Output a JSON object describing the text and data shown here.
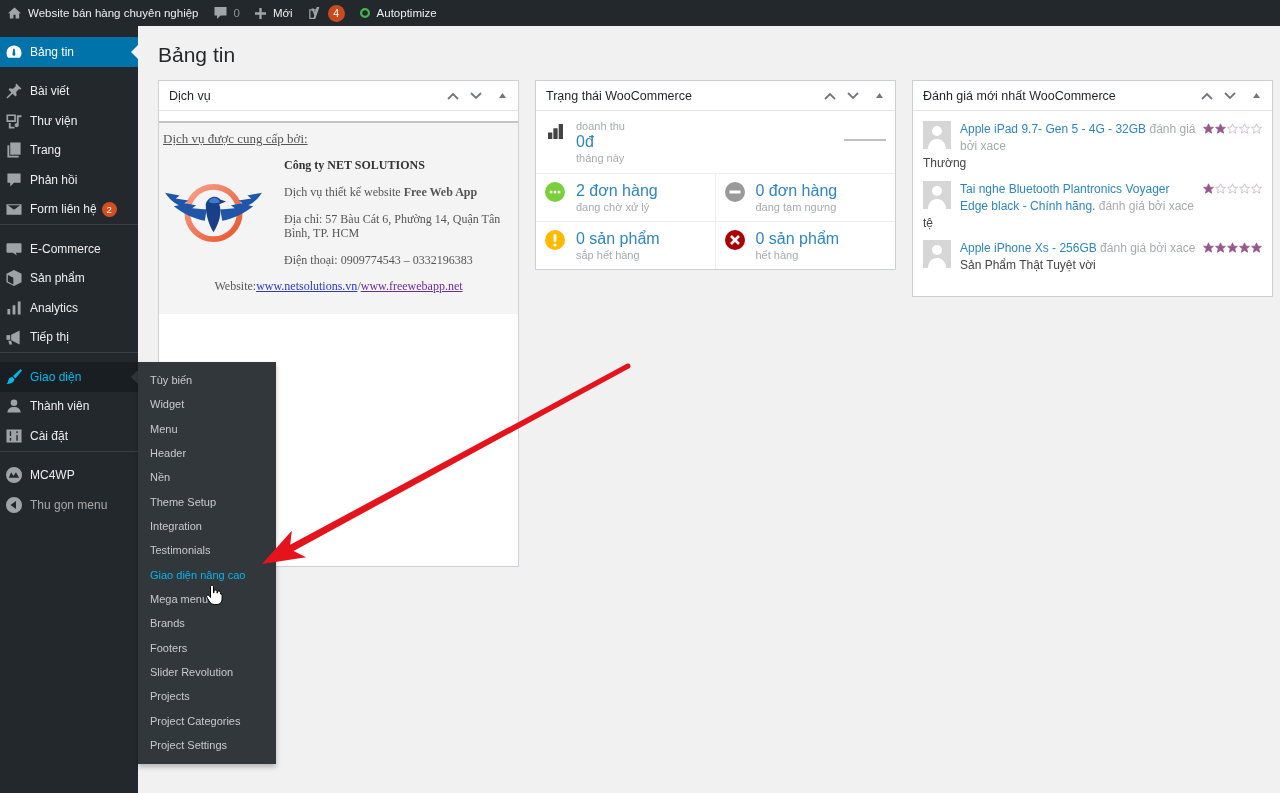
{
  "admin_bar": {
    "site_title": "Website bán hàng chuyên nghiệp",
    "comment_count": "0",
    "new_label": "Mới",
    "seo_count": "4",
    "plugin_label": "Autoptimize"
  },
  "sidebar": {
    "groups": [
      {
        "divider": false,
        "items": [
          {
            "kind": "dashboard",
            "label": "Bảng tin",
            "selected": true,
            "expanded": false
          }
        ]
      },
      {
        "divider": false,
        "items": [
          {
            "kind": "posts",
            "label": "Bài viết",
            "selected": false,
            "expanded": false
          },
          {
            "kind": "media",
            "label": "Thư viện",
            "selected": false,
            "expanded": false
          },
          {
            "kind": "pages",
            "label": "Trang",
            "selected": false,
            "expanded": false
          },
          {
            "kind": "comments",
            "label": "Phản hồi",
            "selected": false,
            "expanded": false
          },
          {
            "kind": "contact",
            "label": "Form liên hệ",
            "selected": false,
            "expanded": false,
            "badge": "2"
          }
        ]
      },
      {
        "divider": true,
        "items": [
          {
            "kind": "woocommerce",
            "label": "E-Commerce",
            "selected": false,
            "expanded": false
          },
          {
            "kind": "products",
            "label": "Sản phẩm",
            "selected": false,
            "expanded": false
          },
          {
            "kind": "analytics",
            "label": "Analytics",
            "selected": false,
            "expanded": false
          },
          {
            "kind": "marketing",
            "label": "Tiếp thị",
            "selected": false,
            "expanded": false
          }
        ]
      },
      {
        "divider": true,
        "items": [
          {
            "kind": "appearance",
            "label": "Giao diện",
            "selected": false,
            "expanded": true,
            "submenu": [
              {
                "label": "Tùy biến",
                "selected": false
              },
              {
                "label": "Widget",
                "selected": false
              },
              {
                "label": "Menu",
                "selected": false
              },
              {
                "label": "Header",
                "selected": false
              },
              {
                "label": "Nền",
                "selected": false
              },
              {
                "label": "Theme Setup",
                "selected": false
              },
              {
                "label": "Integration",
                "selected": false
              },
              {
                "label": "Testimonials",
                "selected": false
              },
              {
                "label": "Giao diện nâng cao",
                "selected": true
              },
              {
                "label": "Mega menu",
                "selected": false
              },
              {
                "label": "Brands",
                "selected": false
              },
              {
                "label": "Footers",
                "selected": false
              },
              {
                "label": "Slider Revolution",
                "selected": false
              },
              {
                "label": "Projects",
                "selected": false
              },
              {
                "label": "Project Categories",
                "selected": false
              },
              {
                "label": "Project Settings",
                "selected": false
              }
            ]
          },
          {
            "kind": "users",
            "label": "Thành viên",
            "selected": false,
            "expanded": false
          },
          {
            "kind": "settings",
            "label": "Cài đặt",
            "selected": false,
            "expanded": false
          }
        ]
      },
      {
        "divider": true,
        "items": [
          {
            "kind": "mc4wp",
            "label": "MC4WP",
            "selected": false,
            "expanded": false
          }
        ]
      }
    ],
    "collapse_label": "Thu gọn menu"
  },
  "page_title": "Bảng tin",
  "widgets": [
    {
      "kind": "service",
      "title": "Dịch vụ",
      "intro": "Dịch vụ được cung cấp bởi:",
      "company": "Công ty NET SOLUTIONS",
      "lines": [
        "Dịch vụ thiết kế website **Free Web App**",
        "Địa chỉ: 57 Bàu Cát 6, Phường 14, Quận Tân Bình, TP. HCM",
        "Điện thoại: 0909774543 – 0332196383"
      ],
      "website_label": "Website:",
      "links": [
        {
          "text": "www.netsolutions.vn",
          "visited": false
        },
        {
          "text": "www.freewebapp.net",
          "visited": true
        }
      ],
      "link_separator": "/"
    },
    {
      "kind": "status",
      "title": "Trạng thái WooCommerce",
      "sales": {
        "label": "doanh thu",
        "amount": "0đ",
        "period": "tháng này"
      },
      "stats": [
        {
          "kind": "processing",
          "value": "2 đơn hàng",
          "caption": "đang chờ xử lý"
        },
        {
          "kind": "on-hold",
          "value": "0 đơn hàng",
          "caption": "đang tạm ngưng"
        },
        {
          "kind": "low-stock",
          "value": "0 sản phẩm",
          "caption": "sắp hết hàng"
        },
        {
          "kind": "out-of-stock",
          "value": "0 sản phẩm",
          "caption": "hết hàng"
        }
      ]
    },
    {
      "kind": "reviews",
      "title": "Đánh giá mới nhất WooCommerce",
      "reviews": [
        {
          "product": "Apple iPad 9.7- Gen 5 - 4G - 32GB",
          "byline": "đánh giá bởi xace",
          "stars": 2,
          "comment": "Thường"
        },
        {
          "product": "Tai nghe Bluetooth Plantronics Voyager Edge black - Chính hãng.",
          "byline": "đánh giá bởi xace",
          "stars": 1,
          "comment": "tệ"
        },
        {
          "product": "Apple iPhone Xs - 256GB",
          "byline": "đánh giá bởi xace",
          "stars": 5,
          "comment": "Sản Phẩm Thật Tuyệt vời"
        }
      ]
    }
  ]
}
